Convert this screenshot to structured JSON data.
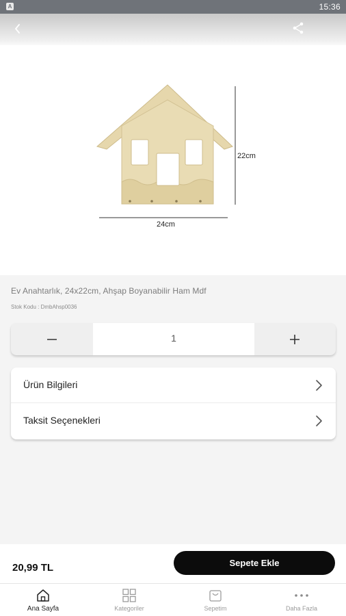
{
  "status_bar": {
    "time": "15:36",
    "app_icon_letter": "A"
  },
  "header": {
    "back_icon": "chevron-left-icon",
    "share_icon": "share-icon"
  },
  "product_image": {
    "width_label": "24cm",
    "height_label": "22cm"
  },
  "product": {
    "title": "Ev Anahtarlık, 24x22cm, Ahşap Boyanabilir Ham Mdf",
    "stock_code": "Stok Kodu : DmbAhsp0036"
  },
  "quantity": {
    "value": "1",
    "minus_icon": "minus-icon",
    "plus_icon": "plus-icon"
  },
  "info_rows": [
    {
      "label": "Ürün Bilgileri"
    },
    {
      "label": "Taksit Seçenekleri"
    }
  ],
  "buy_bar": {
    "price": "20,99 TL",
    "add_to_cart": "Sepete Ekle"
  },
  "bottom_nav": [
    {
      "label": "Ana Sayfa",
      "icon": "home-icon",
      "active": true
    },
    {
      "label": "Kategoriler",
      "icon": "grid-icon",
      "active": false
    },
    {
      "label": "Sepetim",
      "icon": "bag-icon",
      "active": false
    },
    {
      "label": "Daha Fazla",
      "icon": "more-icon",
      "active": false
    }
  ],
  "colors": {
    "primary_button": "#0c0c0c",
    "background": "#f4f4f4",
    "card": "#ffffff",
    "status_bar": "#6f7379"
  }
}
